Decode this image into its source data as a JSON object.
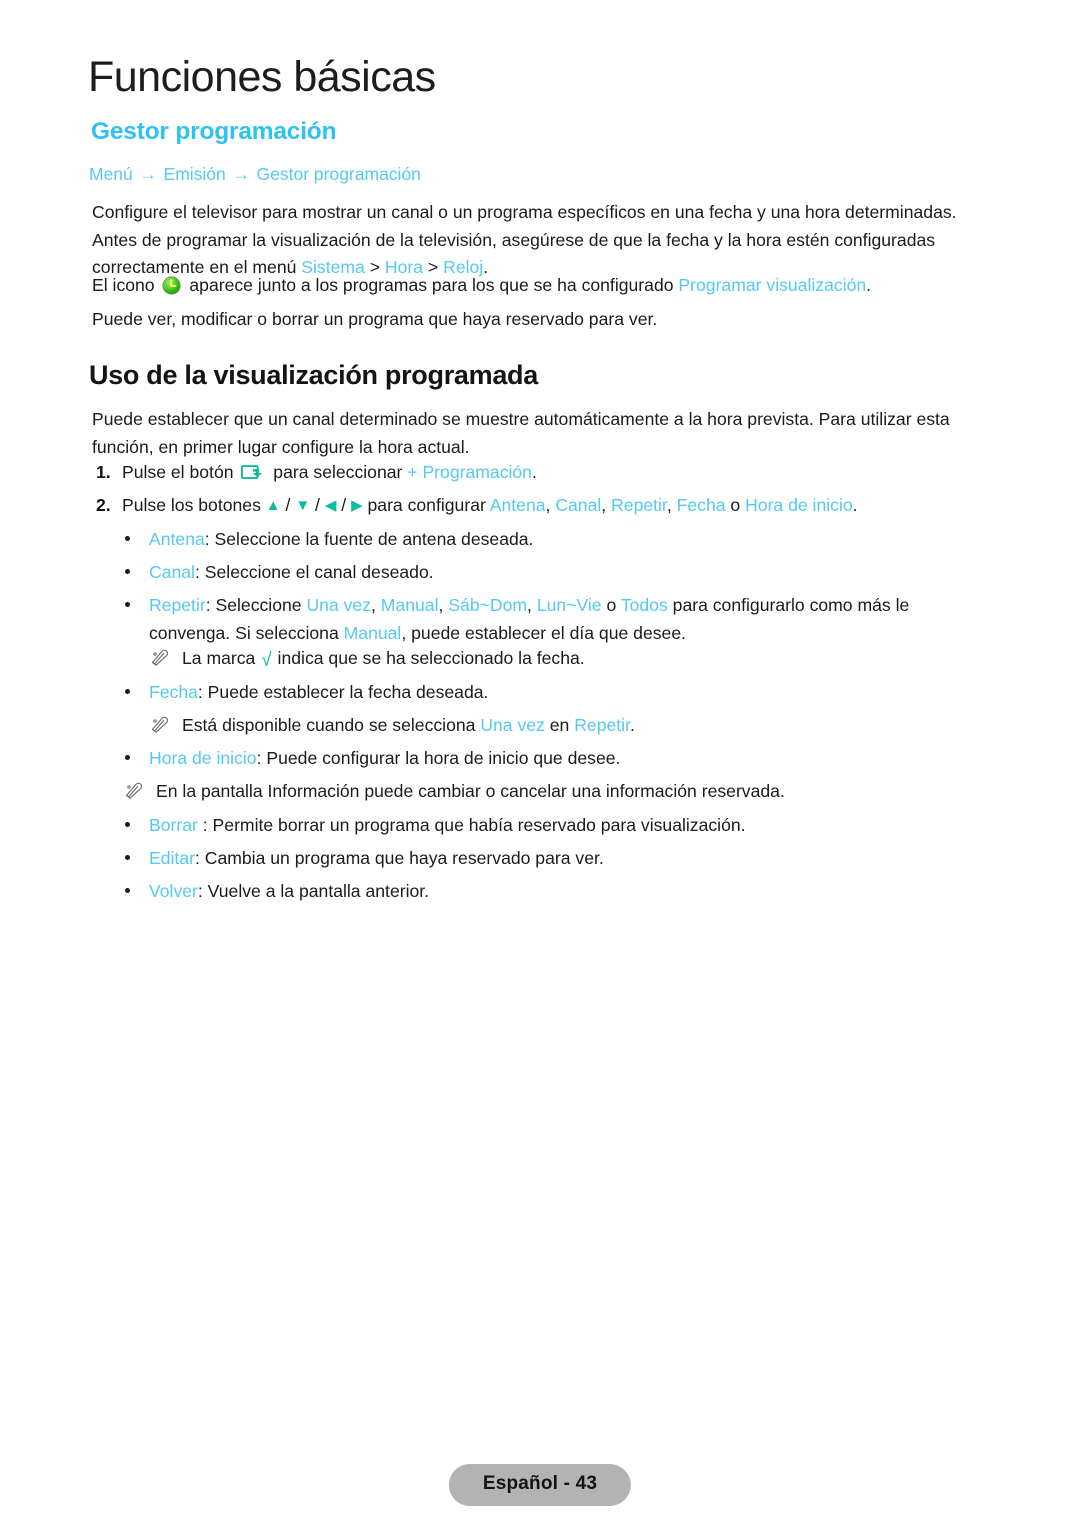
{
  "document": {
    "chapter_title": "Funciones básicas",
    "section_title": "Gestor programación"
  },
  "breadcrumb": {
    "item1": "Menú",
    "arrow1": "→",
    "item2": "Emisión",
    "arrow2": "→",
    "item3": "Gestor programación"
  },
  "intro": {
    "p1_part1": "Configure el televisor para mostrar un canal o un programa específicos en una fecha y una hora determinadas. Antes de programar la visualización de la televisión, asegúrese de que la fecha y la hora estén configuradas correctamente en el menú ",
    "p1_link1": "Sistema",
    "p1_sep1": " > ",
    "p1_link2": "Hora",
    "p1_sep2": " > ",
    "p1_link3": "Reloj",
    "p1_end": ".",
    "p2_part1": "El icono ",
    "p2_icon": "clock-icon",
    "p2_part2": " aparece junto a los programas para los que se ha configurado ",
    "p2_link": "Programar visualización",
    "p2_end": ".",
    "p3": "Puede ver, modificar o borrar un programa que haya reservado para ver."
  },
  "section2": {
    "heading": "Uso de la visualización programada",
    "paragraph": "Puede establecer que un canal determinado se muestre automáticamente a la hora prevista. Para utilizar esta función, en primer lugar configure la hora actual."
  },
  "steps": [
    {
      "number": "1.",
      "text_before_icon": "Pulse el botón ",
      "icon": "enter-key-icon",
      "text_after_icon": " para seleccionar  ",
      "link": "+ Programación",
      "text_end": "."
    },
    {
      "number": "2.",
      "text_before_icon": "Pulse los botones ",
      "arrow_up": "▲",
      "arrow_down": "▼",
      "arrow_left": "◀",
      "arrow_right": "▶",
      "separator": " / ",
      "text_after_icon": " para configurar ",
      "link1": "Antena",
      "sep1": ", ",
      "link2": "Canal",
      "sep2": ", ",
      "link3": "Repetir",
      "sep3": ", ",
      "link4": "Fecha",
      "sep4": " o ",
      "link5": "Hora de inicio",
      "text_end": "."
    }
  ],
  "bullets": {
    "antena": {
      "term": "Antena",
      "desc": ": Seleccione la fuente de antena deseada."
    },
    "canal": {
      "term": "Canal",
      "desc": ": Seleccione el canal deseado."
    },
    "repetir": {
      "term": "Repetir",
      "desc_1": ": Seleccione ",
      "opt1": "Una vez",
      "sep1": ", ",
      "opt2": "Manual",
      "sep2": ", ",
      "opt3": "Sáb~Dom",
      "sep3": ", ",
      "opt4": "Lun~Vie",
      "sep4": " o ",
      "opt5": "Todos",
      "desc_2": " para configurarlo como más le convenga. Si selecciona ",
      "opt6": "Manual",
      "desc_3": ", puede establecer el día que desee."
    },
    "fecha": {
      "term": "Fecha",
      "desc": ": Puede establecer la fecha deseada."
    },
    "hora_inicio": {
      "term": "Hora de inicio",
      "desc": ": Puede configurar la hora de inicio que desee."
    },
    "borrar": {
      "term": "Borrar",
      "desc": " : Permite borrar un programa que había reservado para visualización."
    },
    "editar": {
      "term": "Editar",
      "desc": ": Cambia un programa que haya reservado para ver."
    },
    "volver": {
      "term": "Volver",
      "desc": ": Vuelve a la pantalla anterior."
    }
  },
  "notes": {
    "note1": {
      "icon": "pencil-note-icon",
      "text_before": "La marca ",
      "check": "√",
      "text_after": " indica que se ha seleccionado la fecha."
    },
    "note2": {
      "icon": "pencil-note-icon",
      "text_before": "Está disponible cuando se selecciona ",
      "link1": "Una vez",
      "text_mid": " en ",
      "link2": "Repetir",
      "text_end": "."
    },
    "note3": {
      "icon": "pencil-note-icon",
      "text": "En la pantalla Información puede cambiar o cancelar una información reservada."
    }
  },
  "footer": {
    "label": "Español - 43"
  },
  "colors": {
    "link_blue": "#55c9f2",
    "heading_blue": "#2ec2f3",
    "accent_teal": "#0dbd9b",
    "body_text": "#1b1b1b",
    "footer_pill_bg": "#b3b3b3"
  }
}
